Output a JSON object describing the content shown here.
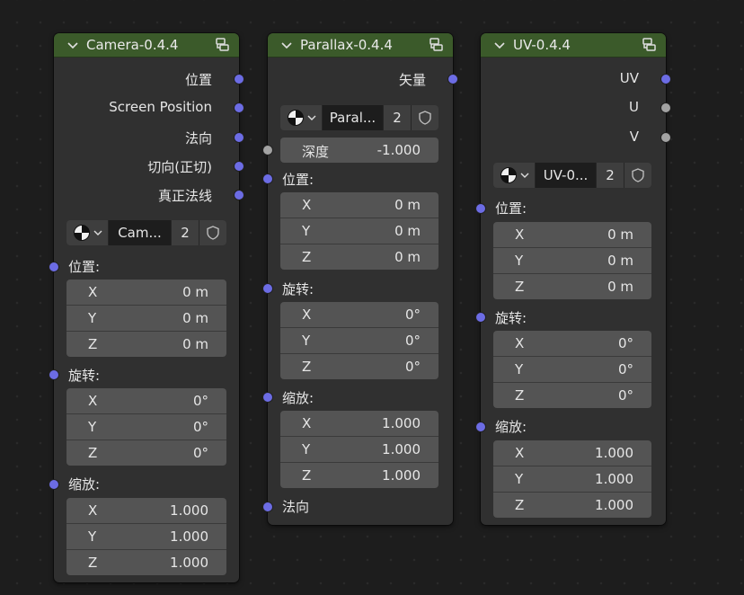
{
  "nodes": {
    "camera": {
      "title": "Camera-0.4.4",
      "outputs": [
        "位置",
        "Screen Position",
        "法向",
        "切向(正切)",
        "真正法线"
      ],
      "datablock": {
        "name": "Cam...",
        "users": "2"
      },
      "location": {
        "label": "位置:",
        "x": "0 m",
        "y": "0 m",
        "z": "0 m"
      },
      "rotation": {
        "label": "旋转:",
        "x": "0°",
        "y": "0°",
        "z": "0°"
      },
      "scale": {
        "label": "缩放:",
        "x": "1.000",
        "y": "1.000",
        "z": "1.000"
      }
    },
    "parallax": {
      "title": "Parallax-0.4.4",
      "outputs": [
        "矢量"
      ],
      "datablock": {
        "name": "Paral...",
        "users": "2"
      },
      "depth": {
        "label": "深度",
        "value": "-1.000"
      },
      "location": {
        "label": "位置:",
        "x": "0 m",
        "y": "0 m",
        "z": "0 m"
      },
      "rotation": {
        "label": "旋转:",
        "x": "0°",
        "y": "0°",
        "z": "0°"
      },
      "scale": {
        "label": "缩放:",
        "x": "1.000",
        "y": "1.000",
        "z": "1.000"
      },
      "normal_input": "法向"
    },
    "uv": {
      "title": "UV-0.4.4",
      "outputs": [
        "UV",
        "U",
        "V"
      ],
      "datablock": {
        "name": "UV-0...",
        "users": "2"
      },
      "location": {
        "label": "位置:",
        "x": "0 m",
        "y": "0 m",
        "z": "0 m"
      },
      "rotation": {
        "label": "旋转:",
        "x": "0°",
        "y": "0°",
        "z": "0°"
      },
      "scale": {
        "label": "缩放:",
        "x": "1.000",
        "y": "1.000",
        "z": "1.000"
      }
    }
  },
  "axes": [
    "X",
    "Y",
    "Z"
  ],
  "icons": {
    "collapse": "chevron-down-icon",
    "node_group": "node-group-icon",
    "datablock_type": "node-tree-sphere-icon",
    "fake_user": "shield-icon"
  },
  "colors": {
    "header": "#3b5a2a",
    "vector_socket": "#6c6ce4",
    "float_socket": "#a3a3a3",
    "node_body": "#303030",
    "field": "#545454"
  }
}
